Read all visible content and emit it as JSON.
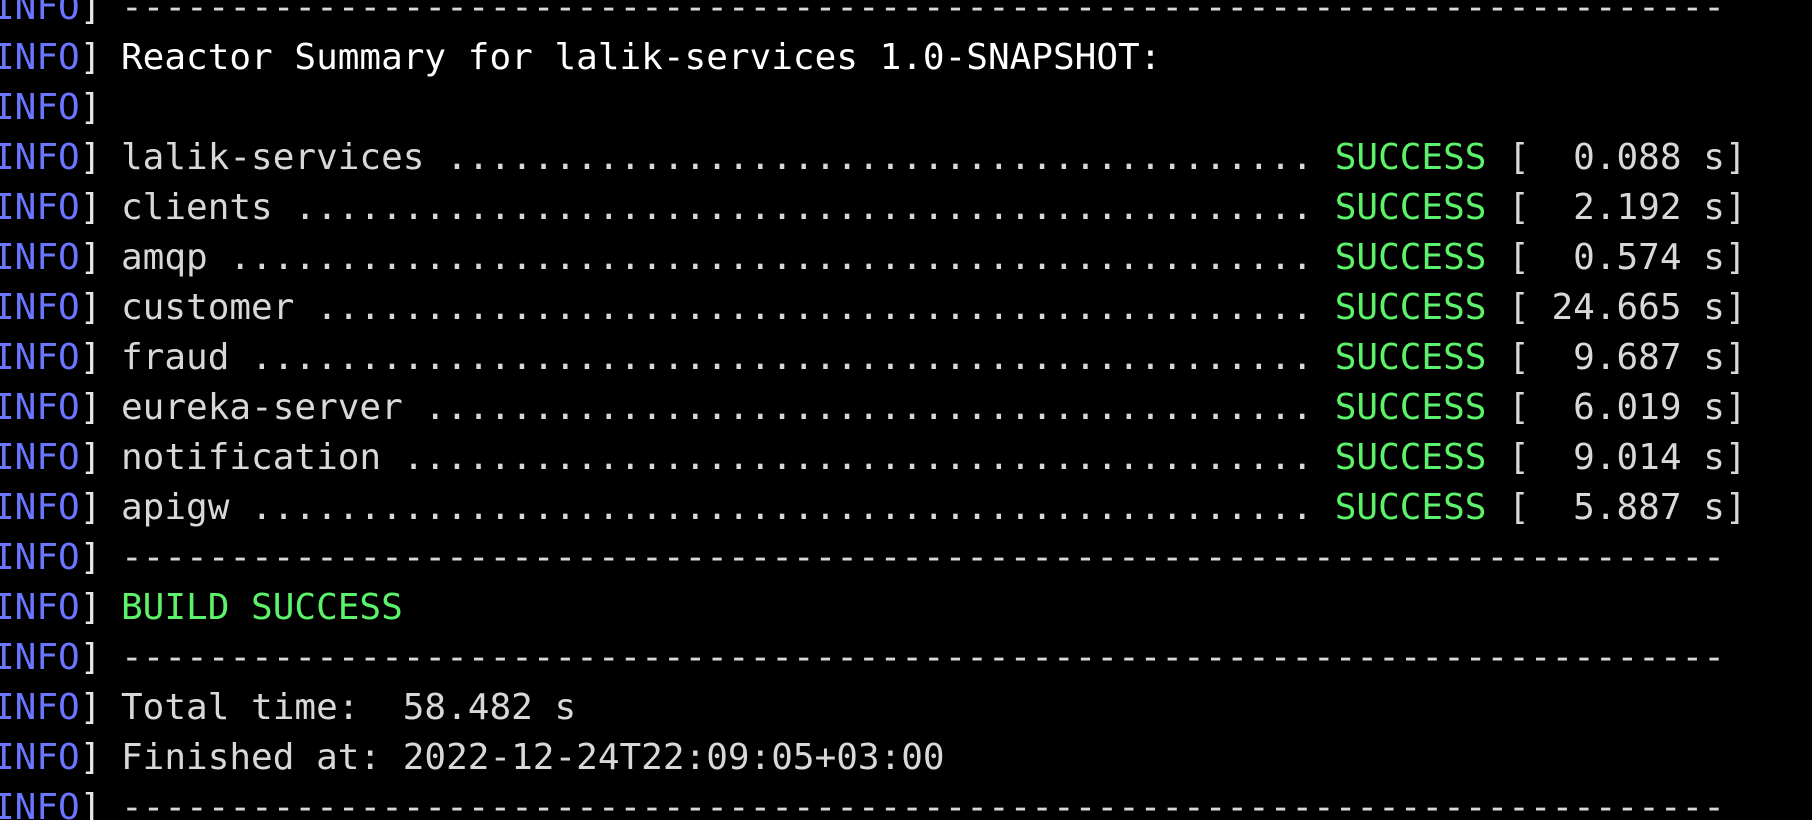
{
  "log_level": "INFO",
  "rule": "--------------------------------------------------------------------------",
  "summary_header": "Reactor Summary for lalik-services 1.0-SNAPSHOT:",
  "modules": [
    {
      "line": "lalik-services ........................................ ",
      "status": "SUCCESS",
      "time": " [  0.088 s]"
    },
    {
      "line": "clients ............................................... ",
      "status": "SUCCESS",
      "time": " [  2.192 s]"
    },
    {
      "line": "amqp .................................................. ",
      "status": "SUCCESS",
      "time": " [  0.574 s]"
    },
    {
      "line": "customer .............................................. ",
      "status": "SUCCESS",
      "time": " [ 24.665 s]"
    },
    {
      "line": "fraud ................................................. ",
      "status": "SUCCESS",
      "time": " [  9.687 s]"
    },
    {
      "line": "eureka-server ......................................... ",
      "status": "SUCCESS",
      "time": " [  6.019 s]"
    },
    {
      "line": "notification .......................................... ",
      "status": "SUCCESS",
      "time": " [  9.014 s]"
    },
    {
      "line": "apigw ................................................. ",
      "status": "SUCCESS",
      "time": " [  5.887 s]"
    }
  ],
  "build_result": "BUILD SUCCESS",
  "total_time": "Total time:  58.482 s",
  "finished_at": "Finished at: 2022-12-24T22:09:05+03:00",
  "colors": {
    "background": "#000000",
    "info_tag": "#6a76ff",
    "success": "#5cf26a",
    "text": "#e0e0e0"
  }
}
